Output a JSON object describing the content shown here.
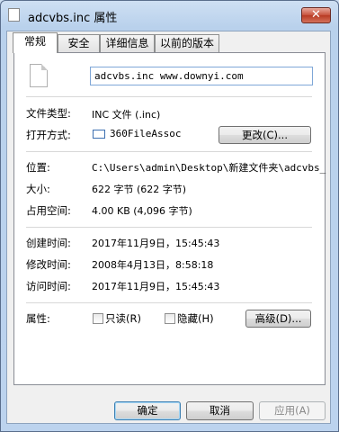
{
  "window": {
    "title": "adcvbs.inc 属性",
    "close_label": "✕"
  },
  "tabs": [
    {
      "label": "常规",
      "active": true
    },
    {
      "label": "安全",
      "active": false
    },
    {
      "label": "详细信息",
      "active": false
    },
    {
      "label": "以前的版本",
      "active": false
    }
  ],
  "general": {
    "file_name": "adcvbs.inc www.downyi.com",
    "file_type_label": "文件类型:",
    "file_type_value": "INC 文件 (.inc)",
    "open_with_label": "打开方式:",
    "open_with_value": "360FileAssoc",
    "change_button": "更改(C)...",
    "location_label": "位置:",
    "location_value": "C:\\Users\\admin\\Desktop\\新建文件夹\\adcvbs_",
    "size_label": "大小:",
    "size_value": "622 字节 (622 字节)",
    "size_on_disk_label": "占用空间:",
    "size_on_disk_value": "4.00 KB (4,096 字节)",
    "created_label": "创建时间:",
    "created_value": "2017年11月9日，15:45:43",
    "modified_label": "修改时间:",
    "modified_value": "2008年4月13日，8:58:18",
    "accessed_label": "访问时间:",
    "accessed_value": "2017年11月9日，15:45:43",
    "attributes_label": "属性:",
    "readonly_label": "只读(R)",
    "hidden_label": "隐藏(H)",
    "advanced_button": "高级(D)..."
  },
  "footer": {
    "ok": "确定",
    "cancel": "取消",
    "apply": "应用(A)"
  }
}
